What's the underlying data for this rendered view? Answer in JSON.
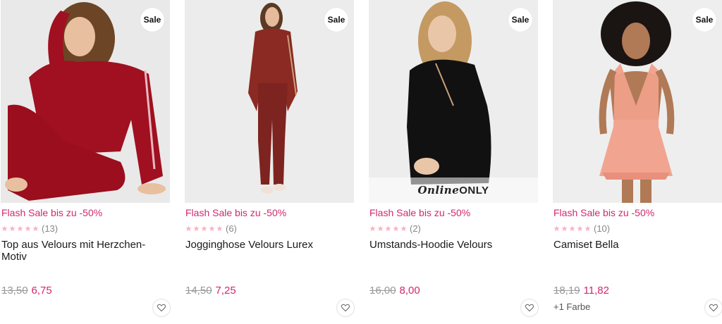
{
  "products": [
    {
      "badge": "Sale",
      "promo": "Flash Sale bis zu -50%",
      "rating_count": "(13)",
      "title": "Top aus Velours mit Herzchen-Motiv",
      "old_price": "13,50",
      "new_price": "6,75",
      "image_tone": "#e9e9e9",
      "garment_color": "#a01020"
    },
    {
      "badge": "Sale",
      "promo": "Flash Sale bis zu -50%",
      "rating_count": "(6)",
      "title": "Jogginghose Velours Lurex",
      "old_price": "14,50",
      "new_price": "7,25",
      "image_tone": "#ececec",
      "garment_color": "#8a2a22"
    },
    {
      "badge": "Sale",
      "promo": "Flash Sale bis zu -50%",
      "rating_count": "(2)",
      "title": "Umstands-Hoodie Velours",
      "old_price": "16,00",
      "new_price": "8,00",
      "image_tone": "#ededed",
      "garment_color": "#111111",
      "online_only_script": "Online",
      "online_only_caps": "ONLY"
    },
    {
      "badge": "Sale",
      "promo": "Flash Sale bis zu -50%",
      "rating_count": "(10)",
      "title": "Camiset Bella",
      "old_price": "18,19",
      "new_price": "11,82",
      "colors_note": "+1 Farbe",
      "image_tone": "#eeeeee",
      "garment_color": "#f0a08a"
    }
  ],
  "theme": {
    "accent": "#d1286f",
    "star_color": "#f2b8c6",
    "old_price_color": "#999999"
  },
  "icons": {
    "wishlist": "heart-outline-icon",
    "rating": "star-icon"
  }
}
